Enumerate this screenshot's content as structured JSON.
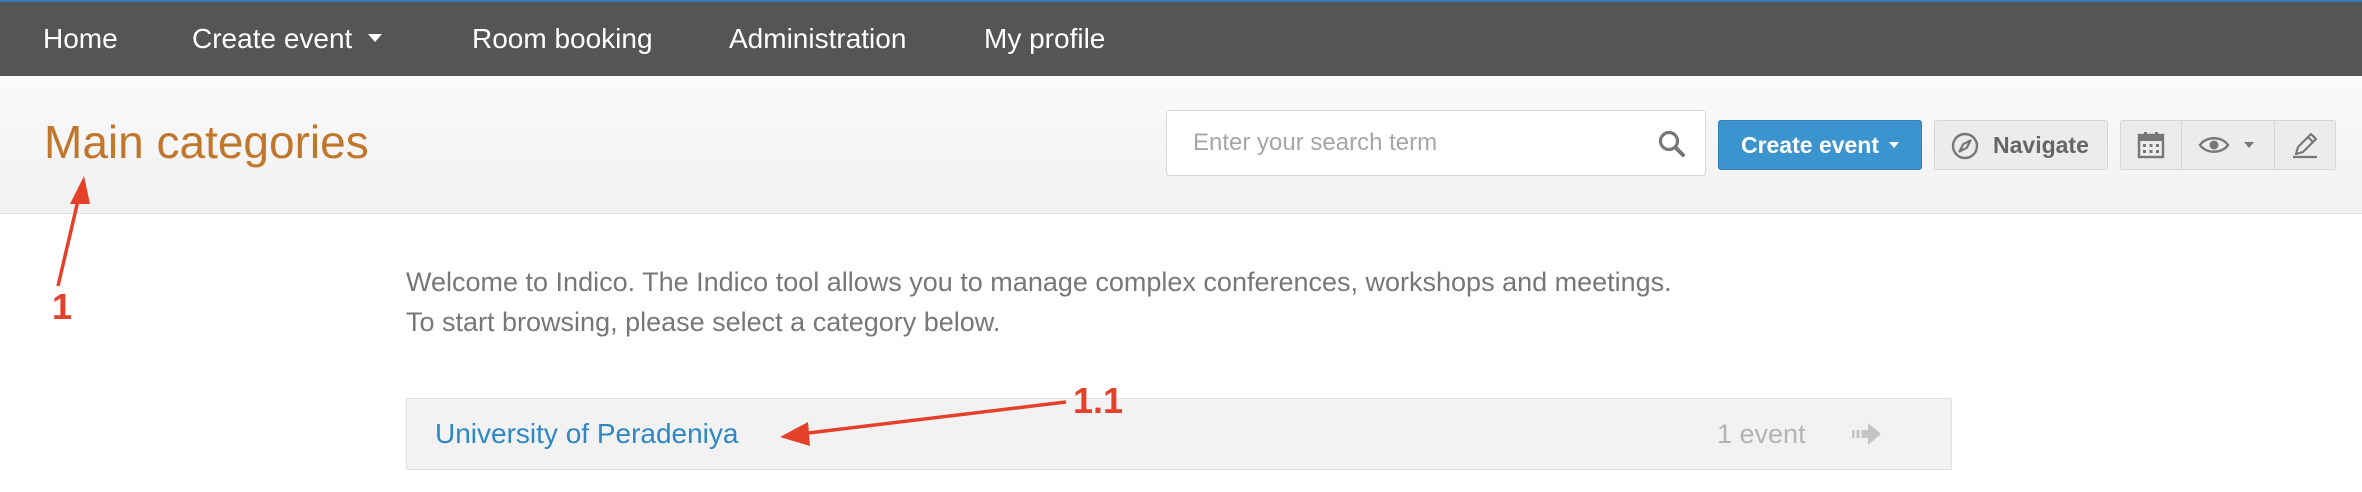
{
  "nav": {
    "items": [
      {
        "label": "Home"
      },
      {
        "label": "Create event",
        "has_dropdown": true
      },
      {
        "label": "Room booking"
      },
      {
        "label": "Administration"
      },
      {
        "label": "My profile"
      }
    ],
    "background": "#555555",
    "accent_top_border": "#3a7bbf"
  },
  "header": {
    "title": "Main categories",
    "title_color": "#c0772c",
    "search": {
      "placeholder": "Enter your search term",
      "value": "",
      "icon": "search-icon"
    },
    "create_event_label": "Create event",
    "create_event_color": "#3c94cf",
    "navigate_label": "Navigate",
    "tools": [
      "calendar-icon",
      "eye-icon",
      "pencil-icon"
    ]
  },
  "content": {
    "welcome_line1": "Welcome to Indico. The Indico tool allows you to manage complex conferences, workshops and meetings.",
    "welcome_line2": "To start browsing, please select a category below.",
    "categories": [
      {
        "name": "University of Peradeniya",
        "count_label": "1 event"
      }
    ]
  },
  "annotations": [
    {
      "label": "1",
      "color": "#e5402a"
    },
    {
      "label": "1.1",
      "color": "#e5402a"
    }
  ]
}
